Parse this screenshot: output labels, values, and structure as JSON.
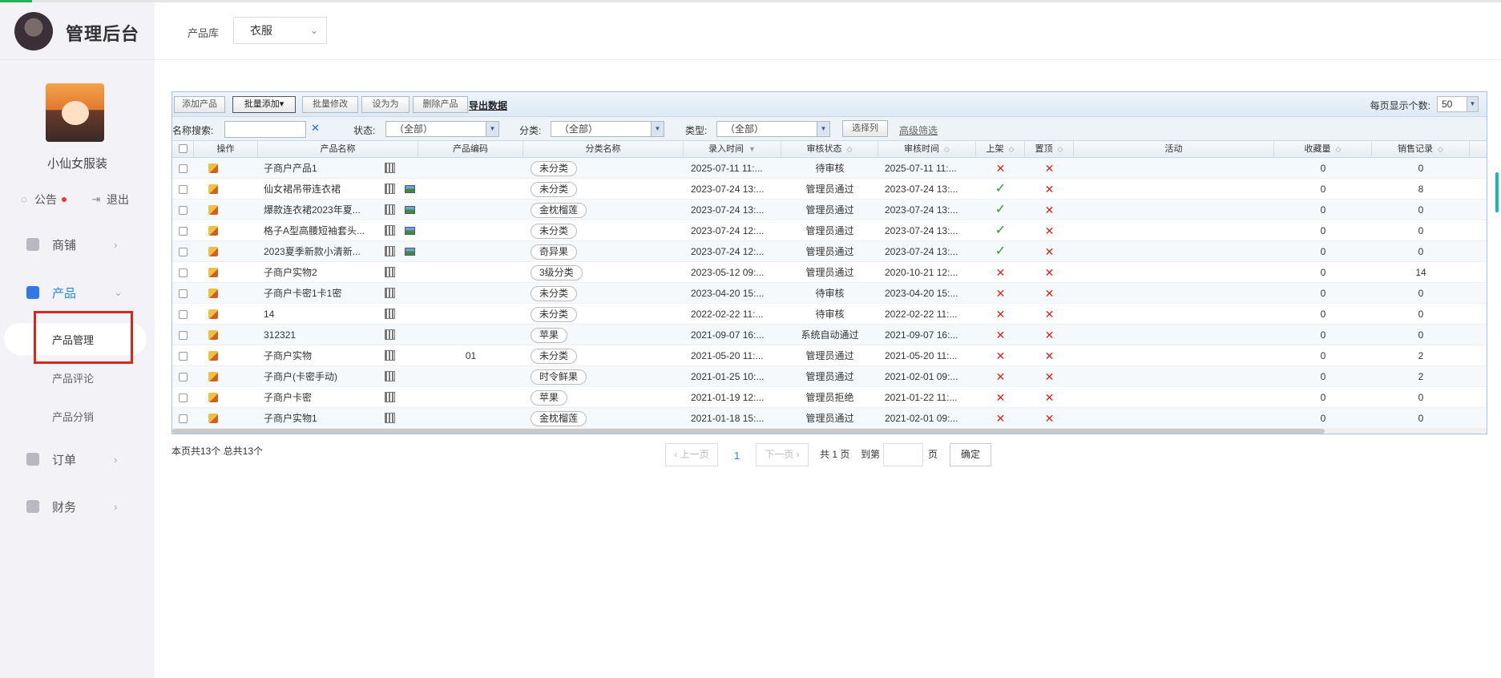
{
  "app": {
    "title": "管理后台"
  },
  "shop": {
    "name": "小仙女服装",
    "notice": "公告",
    "logout": "退出"
  },
  "nav": {
    "shop": "商铺",
    "product": "产品",
    "product_sub": [
      "产品管理",
      "产品评论",
      "产品分销"
    ],
    "order": "订单",
    "finance": "财务"
  },
  "header": {
    "library_label": "产品库",
    "library_value": "衣服"
  },
  "toolbar": {
    "add": "添加产品",
    "batch_add": "批量添加▾",
    "batch_edit": "批量修改",
    "set_as": "设为为",
    "delete": "删除产品",
    "export": "导出数据",
    "perpage_label": "每页显示个数:",
    "perpage_value": "50"
  },
  "filters": {
    "name_label": "名称搜索:",
    "status_label": "状态:",
    "status_value": "（全部）",
    "category_label": "分类:",
    "category_value": "（全部）",
    "type_label": "类型:",
    "type_value": "（全部）",
    "select_cols": "选择列",
    "advanced": "高级筛选"
  },
  "columns": [
    "操作",
    "产品名称",
    "产品编码",
    "分类名称",
    "录入时间",
    "审核状态",
    "审核时间",
    "上架",
    "置顶",
    "活动",
    "收藏量",
    "销售记录"
  ],
  "rows": [
    {
      "name": "子商户产品1",
      "code": "",
      "cat": "未分类",
      "created": "2025-07-11 11:...",
      "status": "待审核",
      "audit": "2025-07-11 11:...",
      "on": false,
      "top": false,
      "img": false,
      "fav": "0",
      "sales": "0"
    },
    {
      "name": "仙女裙吊带连衣裙",
      "code": "",
      "cat": "未分类",
      "created": "2023-07-24 13:...",
      "status": "管理员通过",
      "audit": "2023-07-24 13:...",
      "on": true,
      "top": false,
      "img": true,
      "fav": "0",
      "sales": "8"
    },
    {
      "name": "爆款连衣裙2023年夏...",
      "code": "",
      "cat": "金枕榴莲",
      "created": "2023-07-24 13:...",
      "status": "管理员通过",
      "audit": "2023-07-24 13:...",
      "on": true,
      "top": false,
      "img": true,
      "fav": "0",
      "sales": "0"
    },
    {
      "name": "格子A型高腰短袖套头...",
      "code": "",
      "cat": "未分类",
      "created": "2023-07-24 12:...",
      "status": "管理员通过",
      "audit": "2023-07-24 13:...",
      "on": true,
      "top": false,
      "img": true,
      "fav": "0",
      "sales": "0"
    },
    {
      "name": "2023夏季新款小清新...",
      "code": "",
      "cat": "奇异果",
      "created": "2023-07-24 12:...",
      "status": "管理员通过",
      "audit": "2023-07-24 13:...",
      "on": true,
      "top": false,
      "img": true,
      "fav": "0",
      "sales": "0"
    },
    {
      "name": "子商户实物2",
      "code": "",
      "cat": "3级分类",
      "created": "2023-05-12 09:...",
      "status": "管理员通过",
      "audit": "2020-10-21 12:...",
      "on": false,
      "top": false,
      "img": false,
      "fav": "0",
      "sales": "14"
    },
    {
      "name": "子商户卡密1卡1密",
      "code": "",
      "cat": "未分类",
      "created": "2023-04-20 15:...",
      "status": "待审核",
      "audit": "2023-04-20 15:...",
      "on": false,
      "top": false,
      "img": false,
      "fav": "0",
      "sales": "0"
    },
    {
      "name": "14",
      "code": "",
      "cat": "未分类",
      "created": "2022-02-22 11:...",
      "status": "待审核",
      "audit": "2022-02-22 11:...",
      "on": false,
      "top": false,
      "img": false,
      "fav": "0",
      "sales": "0"
    },
    {
      "name": "312321",
      "code": "",
      "cat": "苹果",
      "created": "2021-09-07 16:...",
      "status": "系统自动通过",
      "audit": "2021-09-07 16:...",
      "on": false,
      "top": false,
      "img": false,
      "fav": "0",
      "sales": "0"
    },
    {
      "name": "子商户实物",
      "code": "01",
      "cat": "未分类",
      "created": "2021-05-20 11:...",
      "status": "管理员通过",
      "audit": "2021-05-20 11:...",
      "on": false,
      "top": false,
      "img": false,
      "fav": "0",
      "sales": "2"
    },
    {
      "name": "子商户(卡密手动)",
      "code": "",
      "cat": "时令鲜果",
      "created": "2021-01-25 10:...",
      "status": "管理员通过",
      "audit": "2021-02-01 09:...",
      "on": false,
      "top": false,
      "img": false,
      "fav": "0",
      "sales": "2"
    },
    {
      "name": "子商户卡密",
      "code": "",
      "cat": "苹果",
      "created": "2021-01-19 12:...",
      "status": "管理员拒绝",
      "audit": "2021-01-22 11:...",
      "on": false,
      "top": false,
      "img": false,
      "fav": "0",
      "sales": "0"
    },
    {
      "name": "子商户实物1",
      "code": "",
      "cat": "金枕榴莲",
      "created": "2021-01-18 15:...",
      "status": "管理员通过",
      "audit": "2021-02-01 09:...",
      "on": false,
      "top": false,
      "img": false,
      "fav": "0",
      "sales": "0"
    }
  ],
  "footer": {
    "summary": "本页共13个 总共13个",
    "prev": "上一页",
    "page": "1",
    "next": "下一页",
    "total": "共 1 页",
    "goto": "到第",
    "page_unit": "页",
    "confirm": "确定"
  },
  "marks": {
    "yes": "✓",
    "no": "✕"
  }
}
